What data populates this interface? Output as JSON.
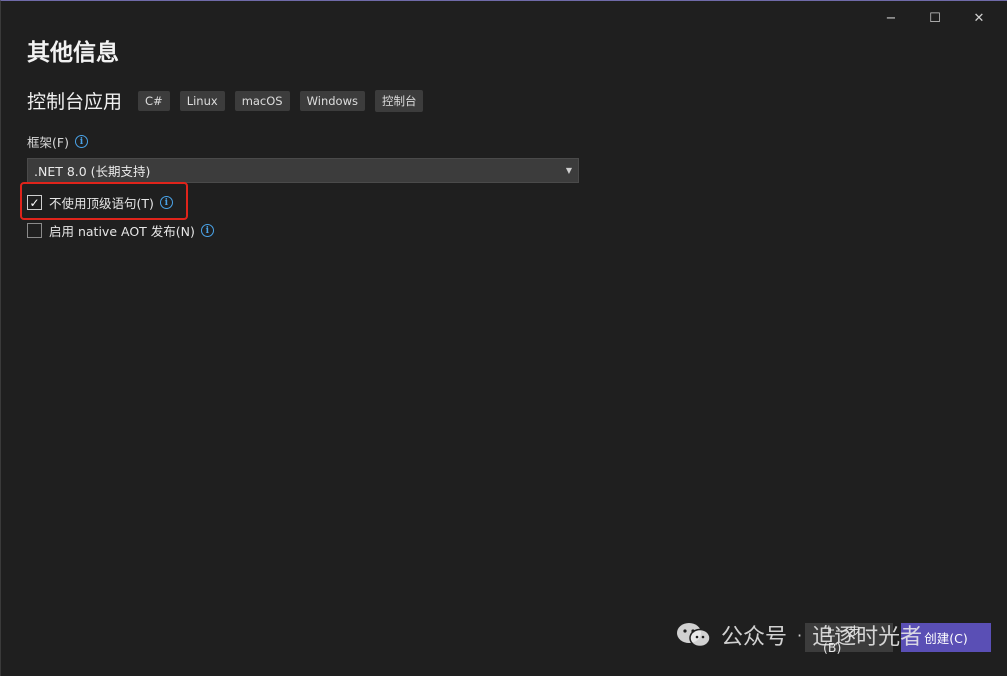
{
  "window": {
    "controls": {
      "minimize": "−",
      "maximize": "☐",
      "close": "✕"
    }
  },
  "page": {
    "title": "其他信息",
    "template_name": "控制台应用",
    "tags": [
      "C#",
      "Linux",
      "macOS",
      "Windows",
      "控制台"
    ]
  },
  "framework": {
    "label": "框架(F)",
    "selected": ".NET 8.0 (长期支持)"
  },
  "options": {
    "top_level": {
      "label": "不使用顶级语句(T)",
      "checked": true
    },
    "aot": {
      "label": "启用 native AOT 发布(N)",
      "checked": false
    }
  },
  "footer": {
    "back_label": "上一步(B)",
    "create_label": "创建(C)"
  },
  "watermark": {
    "prefix": "公众号",
    "separator": "·",
    "name": "追逐时光者"
  },
  "colors": {
    "accent": "#5a4fb5",
    "highlight": "#e0241b",
    "info": "#4aa3e8"
  }
}
